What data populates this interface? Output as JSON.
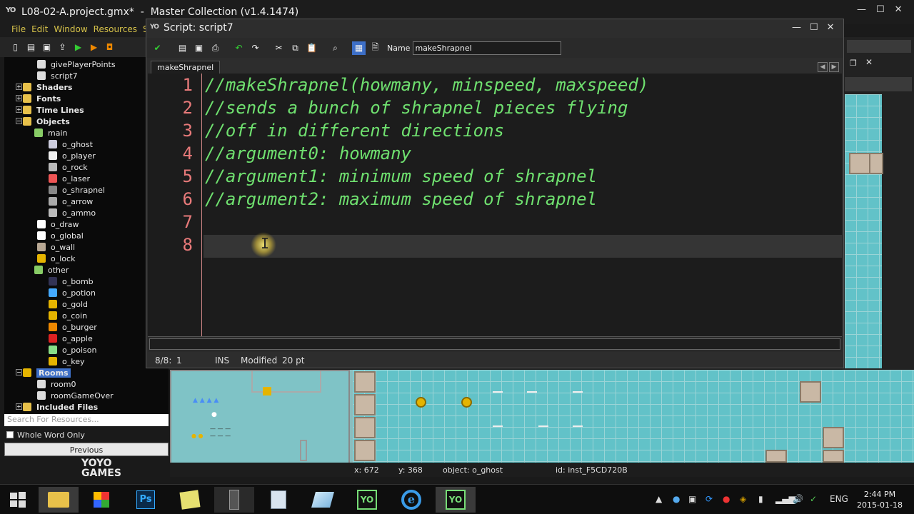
{
  "main_window": {
    "logo": "YO",
    "title": "L08-02-A.project.gmx*  -  Master Collection (v1.4.1474)",
    "menu": [
      "File",
      "Edit",
      "Window",
      "Resources",
      "Sc"
    ]
  },
  "tree": {
    "items": [
      {
        "label": "givePlayerPoints",
        "icon": "script-icon"
      },
      {
        "label": "script7",
        "icon": "script-icon"
      },
      {
        "label": "Shaders",
        "icon": "folder-icon"
      },
      {
        "label": "Fonts",
        "icon": "folder-icon"
      },
      {
        "label": "Time Lines",
        "icon": "folder-icon"
      },
      {
        "label": "Objects",
        "icon": "folder-icon"
      },
      {
        "label": "main",
        "icon": "folder-icon"
      },
      {
        "label": "o_ghost",
        "icon": "ghost-icon"
      },
      {
        "label": "o_player",
        "icon": "player-icon"
      },
      {
        "label": "o_rock",
        "icon": "rock-icon"
      },
      {
        "label": "o_laser",
        "icon": "laser-icon"
      },
      {
        "label": "o_shrapnel",
        "icon": "shrapnel-icon"
      },
      {
        "label": "o_arrow",
        "icon": "arrow-icon"
      },
      {
        "label": "o_ammo",
        "icon": "ammo-icon"
      },
      {
        "label": "o_draw",
        "icon": "blank-icon"
      },
      {
        "label": "o_global",
        "icon": "blank-icon"
      },
      {
        "label": "o_wall",
        "icon": "wall-icon"
      },
      {
        "label": "o_lock",
        "icon": "lock-icon"
      },
      {
        "label": "other",
        "icon": "folder-icon"
      },
      {
        "label": "o_bomb",
        "icon": "bomb-icon"
      },
      {
        "label": "o_potion",
        "icon": "potion-icon"
      },
      {
        "label": "o_gold",
        "icon": "gold-icon"
      },
      {
        "label": "o_coin",
        "icon": "coin-icon"
      },
      {
        "label": "o_burger",
        "icon": "burger-icon"
      },
      {
        "label": "o_apple",
        "icon": "apple-icon"
      },
      {
        "label": "o_poison",
        "icon": "poison-icon"
      },
      {
        "label": "o_key",
        "icon": "key-icon"
      },
      {
        "label": "Rooms",
        "icon": "folder-icon"
      },
      {
        "label": "room0",
        "icon": "room-icon"
      },
      {
        "label": "roomGameOver",
        "icon": "room-icon"
      },
      {
        "label": "Included Files",
        "icon": "folder-icon"
      }
    ]
  },
  "search": {
    "placeholder": "Search For Resources...",
    "whole_word": "Whole Word Only",
    "previous": "Previous"
  },
  "brand": {
    "line1": "YOYO",
    "line2": "GAMES"
  },
  "room_status": {
    "x": "x: 672",
    "y": "y: 368",
    "object": "object: o_ghost",
    "id": "id: inst_F5CD720B"
  },
  "script_window": {
    "title": "Script: script7",
    "name_label": "Name",
    "name_value": "makeShrapnel",
    "tab": "makeShrapnel",
    "lines": [
      "//makeShrapnel(howmany, minspeed, maxspeed)",
      "//sends a bunch of shrapnel pieces flying",
      "//off in different directions",
      "//argument0: howmany",
      "//argument1: minimum speed of shrapnel",
      "//argument2: maximum speed of shrapnel",
      "",
      ""
    ],
    "line_numbers": [
      "1",
      "2",
      "3",
      "4",
      "5",
      "6",
      "7",
      "8"
    ],
    "status": {
      "pos": "8/8:",
      "col": "1",
      "mode": "INS",
      "modified": "Modified",
      "size": "20 pt"
    }
  },
  "taskbar": {
    "apps": [
      "file-explorer-icon",
      "apps-icon",
      "photoshop-icon",
      "sticky-notes-icon",
      "media-center-icon",
      "calculator-icon",
      "glass-icon",
      "gamemaker-icon",
      "internet-explorer-icon",
      "gamemaker-active-icon"
    ],
    "ps_label": "Ps",
    "lang": "ENG",
    "time": "2:44 PM",
    "date": "2015-01-18"
  },
  "colors": {
    "code": "#6fe06f",
    "line_numbers": "#e87a7a",
    "accent": "#3d6fc7"
  }
}
